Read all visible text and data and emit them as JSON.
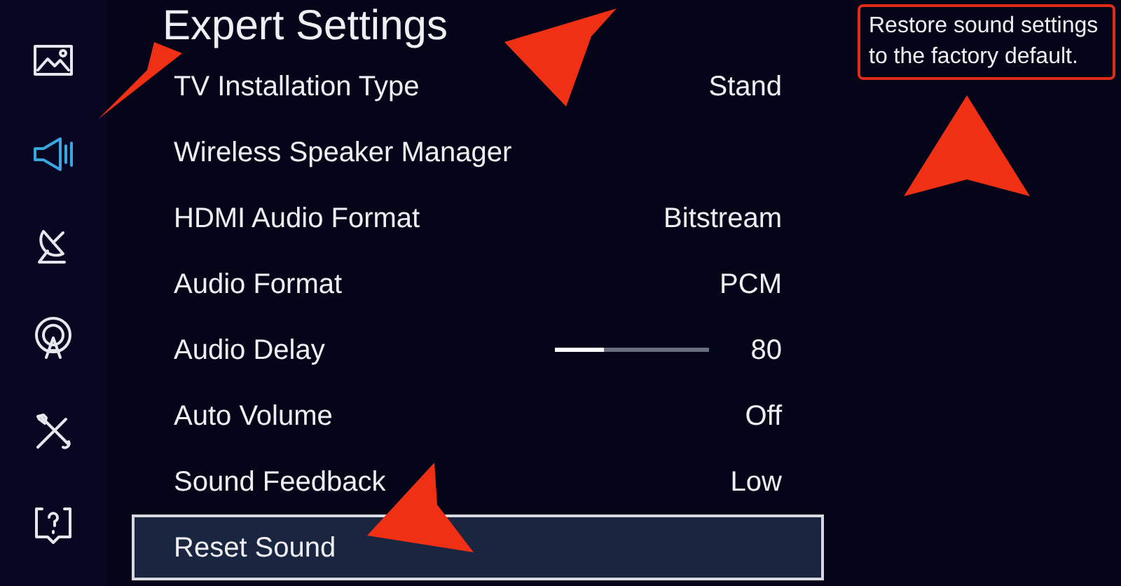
{
  "sidebar": {
    "items": [
      {
        "kind": "picture",
        "selected": false
      },
      {
        "kind": "sound",
        "selected": true
      },
      {
        "kind": "broadcast",
        "selected": false
      },
      {
        "kind": "network",
        "selected": false
      },
      {
        "kind": "tools",
        "selected": false
      },
      {
        "kind": "support",
        "selected": false
      }
    ]
  },
  "title": "Expert Settings",
  "settings": [
    {
      "label": "TV Installation Type",
      "value": "Stand",
      "selected": false
    },
    {
      "label": "Wireless Speaker Manager",
      "selected": false
    },
    {
      "label": "HDMI Audio Format",
      "value": "Bitstream",
      "selected": false
    },
    {
      "label": "Audio Format",
      "value": "PCM",
      "selected": false
    },
    {
      "label": "Audio Delay",
      "value": "80",
      "level": 0.32,
      "selected": false
    },
    {
      "label": "Auto Volume",
      "value": "Off",
      "selected": false
    },
    {
      "label": "Sound Feedback",
      "value": "Low",
      "selected": false
    },
    {
      "label": "Reset Sound",
      "selected": true
    }
  ],
  "help": "Restore sound settings to the factory default."
}
